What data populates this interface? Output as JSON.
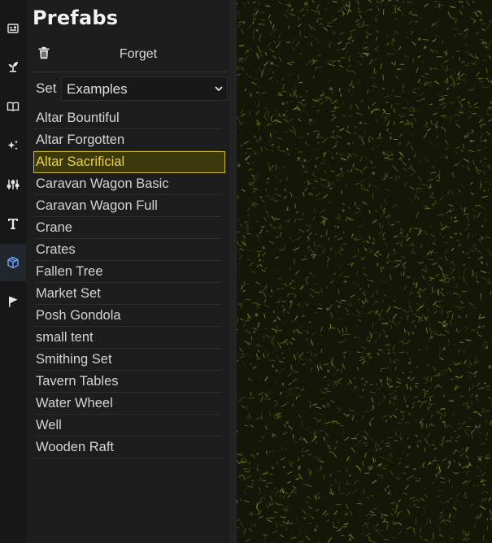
{
  "sidebar": {
    "items": [
      {
        "id": "scene",
        "icon": "image-frame-icon"
      },
      {
        "id": "plant",
        "icon": "seedling-icon"
      },
      {
        "id": "book",
        "icon": "book-icon"
      },
      {
        "id": "effects",
        "icon": "sparkles-icon"
      },
      {
        "id": "adjust",
        "icon": "sliders-icon"
      },
      {
        "id": "text",
        "icon": "text-t-icon"
      },
      {
        "id": "prefabs",
        "icon": "cube-icon",
        "active": true
      },
      {
        "id": "play",
        "icon": "pointer-flag-icon"
      }
    ]
  },
  "panel": {
    "title": "Prefabs",
    "forget_label": "Forget",
    "set_label": "Set",
    "set_value": "Examples",
    "selected_item": "Altar Sacrificial",
    "items": [
      "Altar Bountiful",
      "Altar Forgotten",
      "Altar Sacrificial",
      "Caravan Wagon Basic",
      "Caravan Wagon Full",
      "Crane",
      "Crates",
      "Fallen Tree",
      "Market Set",
      "Posh Gondola",
      "small tent",
      "Smithing Set",
      "Tavern Tables",
      "Water Wheel",
      "Well",
      "Wooden Raft"
    ]
  },
  "colors": {
    "accent_selected_bg": "#3c3a0c",
    "accent_selected_text": "#e8d24a",
    "active_icon": "#6fa8ff",
    "canvas_grass": "#141708"
  }
}
